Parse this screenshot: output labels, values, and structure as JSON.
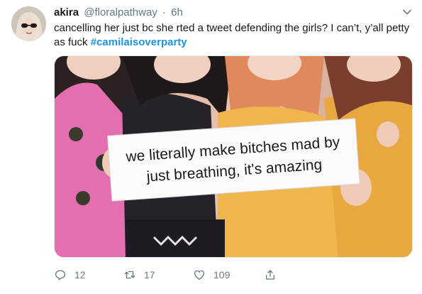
{
  "tweet": {
    "author_name": "akira",
    "handle": "@floralpathway",
    "separator": "·",
    "time": "6h",
    "text": "cancelling her just bc she rted a tweet defending the girls? I can’t, y’all petty as fuck",
    "hashtag": "#camilaisoverparty",
    "media_sign_line1": "we literally make bitches mad by",
    "media_sign_line2": "just breathing, it's amazing"
  },
  "actions": {
    "reply_count": "12",
    "retweet_count": "17",
    "like_count": "109"
  },
  "colors": {
    "link": "#1b95e0",
    "muted": "#657786",
    "text": "#14171a"
  },
  "icons": [
    "caret-down-icon",
    "reply-icon",
    "retweet-icon",
    "like-icon",
    "share-icon"
  ]
}
